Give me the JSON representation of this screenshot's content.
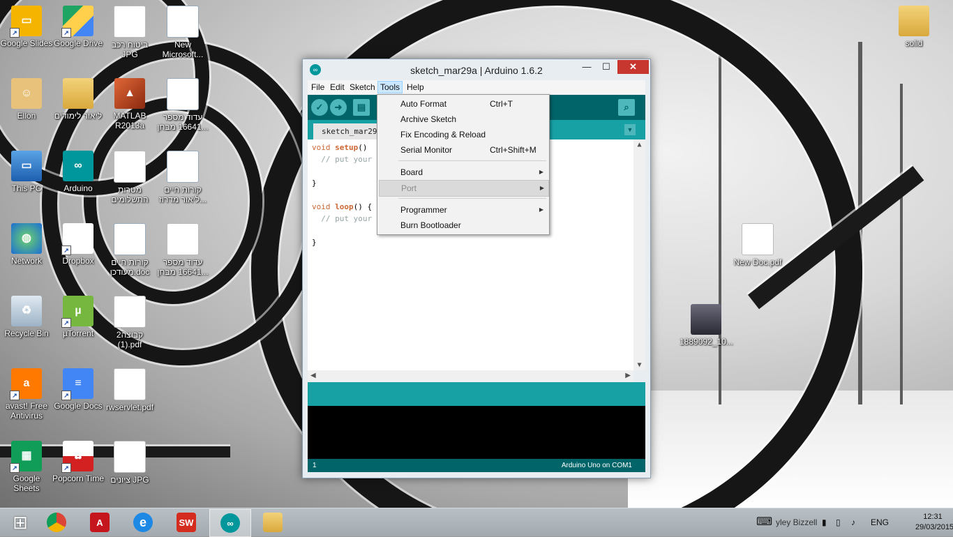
{
  "desktop": {
    "icons": [
      {
        "label": "Google Slides",
        "icon": "google-slides-icon"
      },
      {
        "label": "Google Drive",
        "icon": "google-drive-icon"
      },
      {
        "label": "ביטוח רכב JPG",
        "icon": "image-file-icon"
      },
      {
        "label": "New Microsoft...",
        "icon": "word-document-icon"
      },
      {
        "label": "solid",
        "icon": "folder-icon"
      },
      {
        "label": "Ellon",
        "icon": "user-folder-icon"
      },
      {
        "label": "ליאור לימודים",
        "icon": "folder-icon"
      },
      {
        "label": "MATLAB R2013a",
        "icon": "matlab-icon"
      },
      {
        "label": "עדוד מספר 16641 מבחן...",
        "icon": "word-document-icon"
      },
      {
        "label": "This PC",
        "icon": "computer-icon"
      },
      {
        "label": "Arduino",
        "icon": "arduino-icon"
      },
      {
        "label": "מטרות התשלומים",
        "icon": "pdf-icon"
      },
      {
        "label": "קורות חיים ליאור מדרוז...",
        "icon": "word-document-icon"
      },
      {
        "label": "Network",
        "icon": "network-icon"
      },
      {
        "label": "Dropbox",
        "icon": "dropbox-icon"
      },
      {
        "label": "קורות חיים מעודכן.doc",
        "icon": "word-document-icon"
      },
      {
        "label": "עדוד מספר 16641 מבחן...",
        "icon": "text-file-icon"
      },
      {
        "label": "New Doc.pdf",
        "icon": "pdf-icon"
      },
      {
        "label": "Recycle Bin",
        "icon": "recycle-bin-icon"
      },
      {
        "label": "µTorrent",
        "icon": "utorrent-icon"
      },
      {
        "label": "קבוצה2 (1).pdf",
        "icon": "pdf-icon"
      },
      {
        "label": "1889092_10...",
        "icon": "photo-file-icon"
      },
      {
        "label": "avast! Free Antivirus",
        "icon": "avast-icon"
      },
      {
        "label": "Google Docs",
        "icon": "google-docs-icon"
      },
      {
        "label": "rwservlet.pdf",
        "icon": "pdf-icon"
      },
      {
        "label": "Google Sheets",
        "icon": "google-sheets-icon"
      },
      {
        "label": "Popcorn Time",
        "icon": "popcorn-time-icon"
      },
      {
        "label": "ציונים JPG",
        "icon": "image-file-icon"
      }
    ]
  },
  "window": {
    "title": "sketch_mar29a | Arduino 1.6.2",
    "controls": {
      "minimize": "—",
      "maximize": "☐",
      "close": "✕"
    },
    "menu": [
      "File",
      "Edit",
      "Sketch",
      "Tools",
      "Help"
    ],
    "active_menu": "Tools",
    "tab": "sketch_mar29a",
    "code": {
      "line1_kw": "void",
      "line1_fn": "setup",
      "line1_rest": "()",
      "line2": "  // put your",
      "line3": "}",
      "line4_kw": "void",
      "line4_fn": "loop",
      "line4_rest": "() {",
      "line5": "  // put your",
      "line6": "}"
    },
    "footer": {
      "line": "1",
      "board": "Arduino Uno on COM1"
    }
  },
  "tools_menu": {
    "items": [
      {
        "label": "Auto Format",
        "shortcut": "Ctrl+T"
      },
      {
        "label": "Archive Sketch",
        "shortcut": ""
      },
      {
        "label": "Fix Encoding & Reload",
        "shortcut": ""
      },
      {
        "label": "Serial Monitor",
        "shortcut": "Ctrl+Shift+M"
      },
      {
        "label": "Board",
        "shortcut": ""
      },
      {
        "label": "Port",
        "shortcut": ""
      },
      {
        "label": "Programmer",
        "shortcut": ""
      },
      {
        "label": "Burn Bootloader",
        "shortcut": ""
      }
    ]
  },
  "taskbar": {
    "apps": [
      "start-icon",
      "chrome-icon",
      "acrobat-icon",
      "internet-explorer-icon",
      "solidworks-icon",
      "arduino-icon",
      "file-explorer-icon"
    ],
    "tray_text": "yley Bizzell",
    "language": "ENG",
    "time": "12:31",
    "date": "29/03/2015"
  },
  "colors": {
    "arduino_dark": "#006468",
    "arduino_teal": "#17a1a5",
    "arduino_button": "#4db7bb",
    "close_red": "#c7372f"
  }
}
